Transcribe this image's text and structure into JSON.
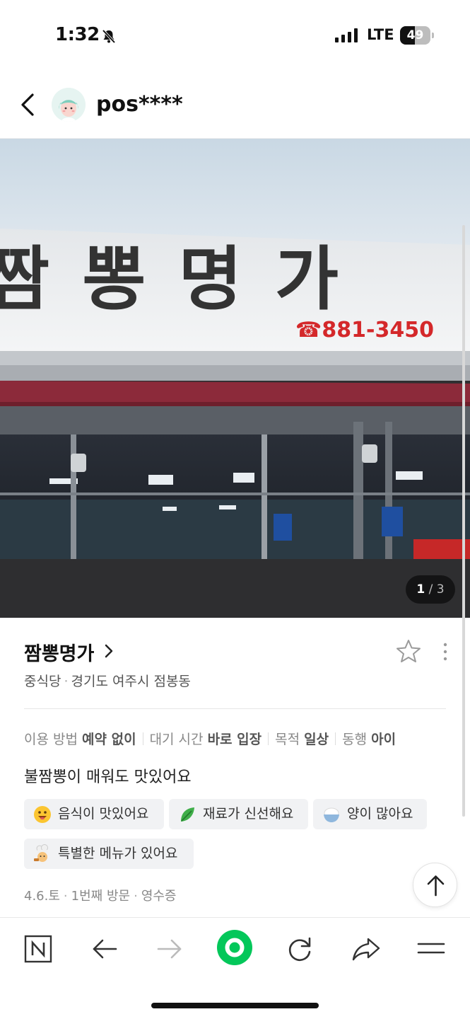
{
  "status_bar": {
    "time": "1:32",
    "carrier": "LTE",
    "battery": "49",
    "battery_level": 0.49
  },
  "header": {
    "username": "pos****",
    "avatar": "avatar-icon"
  },
  "photo": {
    "sign_main": "짬 뽕 명 가",
    "sign_phone": "☎881-3450",
    "counter_current": "1",
    "counter_separator": "/",
    "counter_total": "3"
  },
  "place": {
    "name": "짬뽕명가",
    "category": "중식당",
    "separator": "·",
    "address": "경기도 여주시 점봉동"
  },
  "meta": [
    {
      "label": "이용 방법",
      "value": "예약 없이"
    },
    {
      "label": "대기 시간",
      "value": "바로 입장"
    },
    {
      "label": "목적",
      "value": "일상"
    },
    {
      "label": "동행",
      "value": "아이"
    }
  ],
  "review_text": "불짬뽕이 매워도 맛있어요",
  "tags": [
    {
      "label": "음식이 맛있어요",
      "icon": "smile-emoji-icon"
    },
    {
      "label": "재료가 신선해요",
      "icon": "leaf-emoji-icon"
    },
    {
      "label": "양이 많아요",
      "icon": "rice-bowl-emoji-icon"
    },
    {
      "label": "특별한 메뉴가 있어요",
      "icon": "chef-emoji-icon"
    }
  ],
  "visit": {
    "date": "4.6.토",
    "count": "1번째 방문",
    "proof": "영수증",
    "separator": "·"
  },
  "colors": {
    "accent_green": "#03C75A",
    "phone_red": "#d4282a",
    "awning": "#8c2a3a"
  }
}
